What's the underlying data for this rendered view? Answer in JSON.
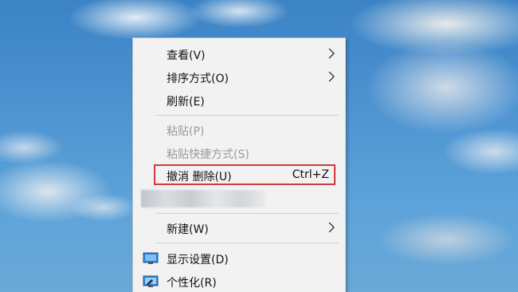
{
  "context_menu": {
    "items": [
      {
        "label": "查看(V)",
        "submenu": true,
        "enabled": true
      },
      {
        "label": "排序方式(O)",
        "submenu": true,
        "enabled": true
      },
      {
        "label": "刷新(E)",
        "submenu": false,
        "enabled": true
      },
      {
        "label": "粘贴(P)",
        "submenu": false,
        "enabled": false
      },
      {
        "label": "粘贴快捷方式(S)",
        "submenu": false,
        "enabled": false
      },
      {
        "label": "撤消 删除(U)",
        "shortcut": "Ctrl+Z",
        "submenu": false,
        "enabled": true,
        "highlighted": true
      },
      {
        "label": "",
        "blurred": true
      },
      {
        "label": "新建(W)",
        "submenu": true,
        "enabled": true
      },
      {
        "label": "显示设置(D)",
        "icon": "display-settings-icon",
        "enabled": true
      },
      {
        "label": "个性化(R)",
        "icon": "personalize-icon",
        "enabled": true
      }
    ]
  },
  "colors": {
    "menu_bg": "#f2f2f2",
    "highlight_border": "#d23a3a",
    "disabled_text": "#9a9a9a"
  }
}
